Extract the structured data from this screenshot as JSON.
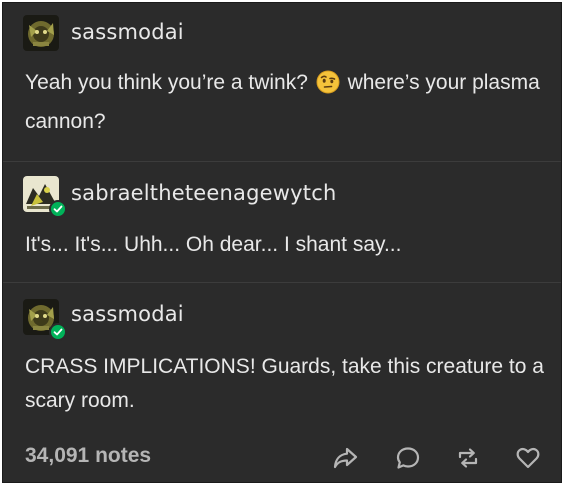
{
  "posts": [
    {
      "username": "sassmodai",
      "text_before_emoji": "Yeah you think you’re a twink? ",
      "emoji": "face-with-raised-eyebrow",
      "text_after_emoji": " where’s your plasma cannon?"
    },
    {
      "username": "sabraeltheteenagewytch",
      "text": "It's... It's... Uhh... Oh dear... I shant say..."
    },
    {
      "username": "sassmodai",
      "text": "CRASS IMPLICATIONS! Guards, take this creature to a scary room."
    }
  ],
  "footer": {
    "notes": "34,091 notes",
    "actions": [
      "share-icon",
      "reply-icon",
      "reblog-icon",
      "like-icon"
    ]
  },
  "colors": {
    "background": "#2b2b2b",
    "text": "#e8e8e8",
    "muted": "#b5b5b5",
    "badge": "#00b259"
  }
}
